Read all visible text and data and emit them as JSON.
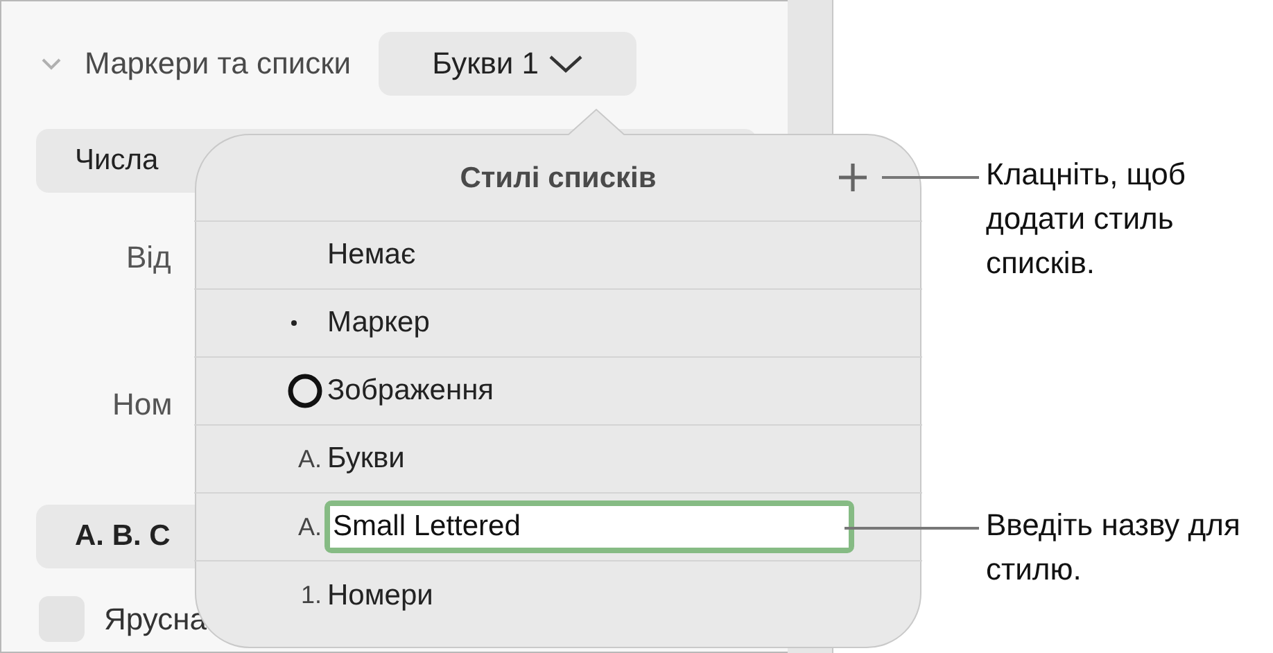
{
  "section": {
    "title": "Маркери та списки",
    "expanded": true,
    "style_button": "Букви 1"
  },
  "background_rows": [
    {
      "kind": "button",
      "text": "Числа"
    },
    {
      "kind": "label",
      "text": "Від"
    },
    {
      "kind": "label",
      "text": "Ном"
    },
    {
      "kind": "button",
      "text": "А. В. С"
    },
    {
      "kind": "checkbox",
      "text": "Ярусна",
      "checked": false
    }
  ],
  "popover": {
    "title": "Стилі списків",
    "items": [
      {
        "kind": "none",
        "label": "Немає",
        "editing": false
      },
      {
        "kind": "bullet",
        "label": "Маркер",
        "editing": false
      },
      {
        "kind": "image",
        "label": "Зображення",
        "editing": false
      },
      {
        "kind": "text",
        "marker": "A.",
        "label": "Букви",
        "editing": false
      },
      {
        "kind": "text",
        "marker": "A.",
        "label": "Small Lettered",
        "editing": true
      },
      {
        "kind": "text",
        "marker": "1.",
        "label": "Номери",
        "editing": false
      }
    ]
  },
  "callouts": [
    "Клацніть, щоб додати стиль списків.",
    "Введіть назву для стилю."
  ]
}
